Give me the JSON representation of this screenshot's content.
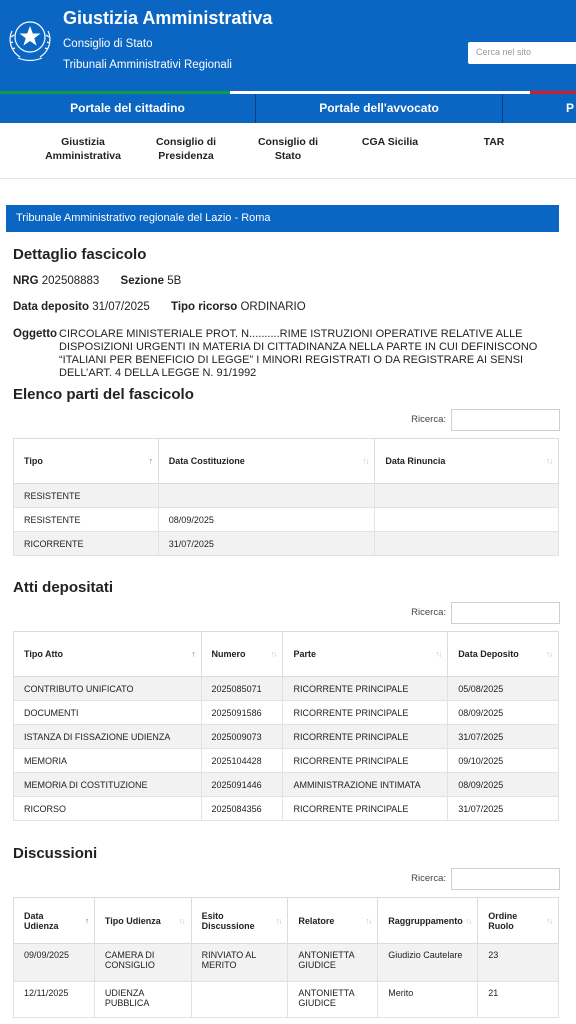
{
  "header": {
    "title": "Giustizia Amministrativa",
    "subtitle1": "Consiglio di Stato",
    "subtitle2": "Tribunali Amministrativi Regionali",
    "search_placeholder": "Cerca nel sito",
    "emblem_icon": "italian-republic-emblem-icon",
    "colors": {
      "brand_blue": "#0a66c2",
      "flag_green": "#109b48",
      "flag_red": "#d31d27"
    }
  },
  "portal_nav": {
    "items": [
      "Portale del cittadino",
      "Portale dell'avvocato",
      "P"
    ]
  },
  "inst_nav": {
    "items": [
      {
        "line1": "Giustizia",
        "line2": "Amministrativa"
      },
      {
        "line1": "Consiglio di",
        "line2": "Presidenza"
      },
      {
        "line1": "Consiglio di",
        "line2": "Stato"
      },
      {
        "line1": "CGA Sicilia",
        "line2": ""
      },
      {
        "line1": "TAR",
        "line2": ""
      }
    ]
  },
  "tribunal": "Tribunale Amministrativo regionale del Lazio - Roma",
  "dettaglio": {
    "title": "Dettaglio fascicolo",
    "nrg_label": "NRG",
    "nrg_value": "202508883",
    "sezione_label": "Sezione",
    "sezione_value": "5B",
    "deposito_label": "Data deposito",
    "deposito_value": "31/07/2025",
    "tipo_label": "Tipo ricorso",
    "tipo_value": "ORDINARIO",
    "oggetto_label": "Oggetto",
    "oggetto_value": "CIRCOLARE MINISTERIALE PROT. N..........RIME ISTRUZIONI OPERATIVE RELATIVE ALLE DISPOSIZIONI URGENTI IN MATERIA DI CITTADINANZA NELLA PARTE IN CUI DEFINISCONO “ITALIANI PER BENEFICIO DI LEGGE” I MINORI REGISTRATI O DA REGISTRARE AI SENSI DELL’ART. 4 DELLA LEGGE N. 91/1992"
  },
  "search_label": "Ricerca:",
  "parti": {
    "title": "Elenco parti del fascicolo",
    "headers": [
      "Tipo",
      "Data Costituzione",
      "Data Rinuncia"
    ],
    "rows": [
      [
        "RESISTENTE",
        "",
        ""
      ],
      [
        "RESISTENTE",
        "08/09/2025",
        ""
      ],
      [
        "RICORRENTE",
        "31/07/2025",
        ""
      ]
    ]
  },
  "atti": {
    "title": "Atti depositati",
    "headers": [
      "Tipo Atto",
      "Numero",
      "Parte",
      "Data Deposito"
    ],
    "rows": [
      [
        "CONTRIBUTO UNIFICATO",
        "2025085071",
        "RICORRENTE PRINCIPALE",
        "05/08/2025"
      ],
      [
        "DOCUMENTI",
        "2025091586",
        "RICORRENTE PRINCIPALE",
        "08/09/2025"
      ],
      [
        "ISTANZA DI FISSAZIONE UDIENZA",
        "2025009073",
        "RICORRENTE PRINCIPALE",
        "31/07/2025"
      ],
      [
        "MEMORIA",
        "2025104428",
        "RICORRENTE PRINCIPALE",
        "09/10/2025"
      ],
      [
        "MEMORIA DI COSTITUZIONE",
        "2025091446",
        "AMMINISTRAZIONE INTIMATA",
        "08/09/2025"
      ],
      [
        "RICORSO",
        "2025084356",
        "RICORRENTE PRINCIPALE",
        "31/07/2025"
      ]
    ]
  },
  "discussioni": {
    "title": "Discussioni",
    "headers": [
      {
        "l1": "Data",
        "l2": "Udienza"
      },
      {
        "l1": "Tipo Udienza",
        "l2": ""
      },
      {
        "l1": "Esito",
        "l2": "Discussione"
      },
      {
        "l1": "Relatore",
        "l2": ""
      },
      {
        "l1": "Raggruppamento",
        "l2": ""
      },
      {
        "l1": "Ordine",
        "l2": "Ruolo"
      }
    ],
    "rows": [
      [
        {
          "l1": "09/09/2025",
          "l2": ""
        },
        {
          "l1": "CAMERA DI",
          "l2": "CONSIGLIO"
        },
        {
          "l1": "RINVIATO AL MERITO",
          "l2": ""
        },
        {
          "l1": "ANTONIETTA",
          "l2": "GIUDICE"
        },
        {
          "l1": "Giudizio Cautelare",
          "l2": ""
        },
        {
          "l1": "23",
          "l2": ""
        }
      ],
      [
        {
          "l1": "12/11/2025",
          "l2": ""
        },
        {
          "l1": "UDIENZA PUBBLICA",
          "l2": ""
        },
        {
          "l1": "",
          "l2": ""
        },
        {
          "l1": "ANTONIETTA",
          "l2": "GIUDICE"
        },
        {
          "l1": "Merito",
          "l2": ""
        },
        {
          "l1": "21",
          "l2": ""
        }
      ]
    ]
  }
}
